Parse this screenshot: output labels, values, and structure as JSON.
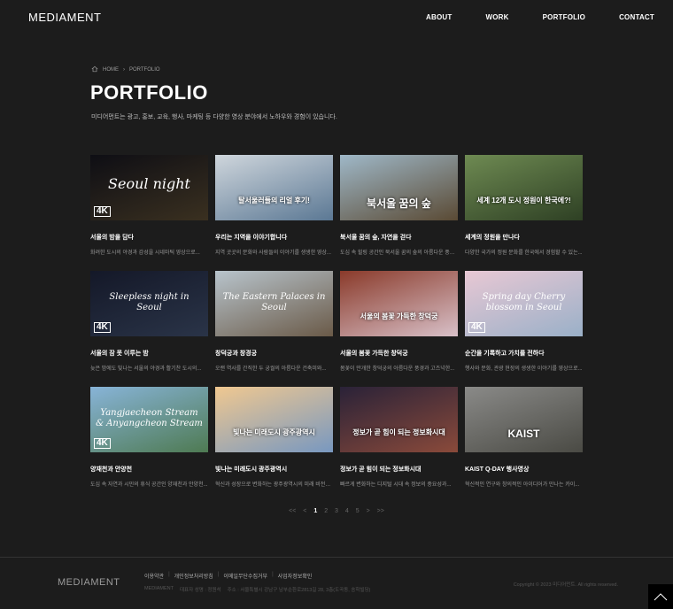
{
  "header": {
    "logo": "MEDIAMENT",
    "nav": [
      "ABOUT",
      "WORK",
      "PORTFOLIO",
      "CONTACT"
    ]
  },
  "breadcrumb": {
    "home": "HOME",
    "current": "PORTFOLIO"
  },
  "page": {
    "title": "PORTFOLIO",
    "description": "미디어먼트는 광고, 홍보, 교육, 행사, 마케팅 등 다양한 영상 분야에서 노하우와 경험이 있습니다."
  },
  "items": [
    {
      "title": "서울의 밤을 담다",
      "desc": "화려한 도시의 야경과 감성을 시네마틱 영상으로...",
      "thumb": {
        "line1": "Seoul night",
        "line2": "",
        "badge": "4K",
        "colors": [
          "#0e0e14",
          "#3a3020"
        ]
      }
    },
    {
      "title": "우리는 지역을 이야기합니다",
      "desc": "지역 곳곳의 문화와 사람들의 이야기를 생생한 영상...",
      "thumb": {
        "line1": "",
        "line2": "탈서울러들의 리얼 후기!",
        "badge": "",
        "colors": [
          "#cfd6dc",
          "#5b7894"
        ]
      }
    },
    {
      "title": "북서울 꿈의 숲, 자연을 걷다",
      "desc": "도심 속 힐링 공간인 북서울 꿈의 숲의 아름다운 풍경...",
      "thumb": {
        "line1": "",
        "line2": "북서울 꿈의 숲",
        "badge": "",
        "colors": [
          "#9fb8c8",
          "#5a4a34"
        ]
      }
    },
    {
      "title": "세계의 정원을 만나다",
      "desc": "다양한 국가의 정원 문화를 한국에서 경험할 수 있는...",
      "thumb": {
        "line1": "",
        "line2": "세계 12개 도시 정원이 한국에?!",
        "badge": "",
        "colors": [
          "#6e8a52",
          "#2e4024"
        ]
      }
    },
    {
      "title": "서울의 잠 못 이루는 밤",
      "desc": "늦은 밤에도 빛나는 서울의 야경과 활기찬 도시의...",
      "thumb": {
        "line1": "Sleepless night in Seoul",
        "line2": "",
        "badge": "4K",
        "colors": [
          "#141828",
          "#2a3448"
        ]
      }
    },
    {
      "title": "창덕궁과 창경궁",
      "desc": "오랜 역사를 간직한 두 궁궐의 아름다운 건축미와...",
      "thumb": {
        "line1": "The Eastern Palaces in Seoul",
        "line2": "",
        "badge": "",
        "colors": [
          "#b8c4cc",
          "#6a5a48"
        ]
      }
    },
    {
      "title": "서울의 봄꽃 가득한 창덕궁",
      "desc": "봄꽃이 만개한 창덕궁의 아름다운 풍경과 고즈넉한...",
      "thumb": {
        "line1": "",
        "line2": "서울의 봄꽃 가득한 창덕궁",
        "badge": "",
        "colors": [
          "#8a3a2a",
          "#d8c0c8"
        ]
      }
    },
    {
      "title": "순간을 기록하고 가치를 전하다",
      "desc": "행사와 문화, 관광 현장의 생생한 이야기를 영상으로...",
      "thumb": {
        "line1": "Spring day Cherry blossom in Seoul",
        "line2": "",
        "badge": "4K",
        "colors": [
          "#e8c8d4",
          "#9ab0c8"
        ]
      }
    },
    {
      "title": "양재천과 안양천",
      "desc": "도심 속 자연과 시민의 휴식 공간인 양재천과 안양천...",
      "thumb": {
        "line1": "Yangjaecheon Stream & Anyangcheon Stream",
        "line2": "",
        "badge": "4K",
        "colors": [
          "#88b4d8",
          "#4e7a52"
        ]
      }
    },
    {
      "title": "빛나는 미래도시 광주광역시",
      "desc": "혁신과 성장으로 변화하는 광주광역시의 미래 비전과...",
      "thumb": {
        "line1": "",
        "line2": "빛나는 미래도시 광주광역시",
        "badge": "",
        "colors": [
          "#f0c890",
          "#7898c0"
        ]
      }
    },
    {
      "title": "정보가 곧 힘이 되는 정보화시대",
      "desc": "빠르게 변화하는 디지털 시대 속 정보의 중요성과...",
      "thumb": {
        "line1": "",
        "line2": "정보가 곧 힘이 되는 정보화시대",
        "badge": "",
        "colors": [
          "#2a2238",
          "#8a4a3a"
        ]
      }
    },
    {
      "title": "KAIST Q-DAY 행사영상",
      "desc": "혁신적인 연구와 창의적인 아이디어가 만나는 카이...",
      "thumb": {
        "line1": "",
        "line2": "KAIST",
        "badge": "",
        "colors": [
          "#8a8a88",
          "#4a4a44"
        ]
      }
    }
  ],
  "pagination": {
    "first": "<<",
    "prev": "<",
    "pages": [
      "1",
      "2",
      "3",
      "4",
      "5"
    ],
    "active": "1",
    "next": ">",
    "last": ">>"
  },
  "footer": {
    "logo": "MEDIAMENT",
    "links": [
      "이용약관",
      "개인정보처리방침",
      "이메일무단수집거부",
      "사업자정보확인"
    ],
    "info": [
      "MEDIAMENT",
      "대표자 성명 : 정원석",
      "주소 : 서울특별시 강남구 남부순환로2813길 28, 3층(도곡동, 송학빌딩)"
    ],
    "copyright": "Copyright © 2023 미디어먼트. All rights reserved."
  },
  "colors": {
    "background": "#1c1c1c",
    "text": "#ffffff",
    "muted": "#9a9a9a"
  }
}
